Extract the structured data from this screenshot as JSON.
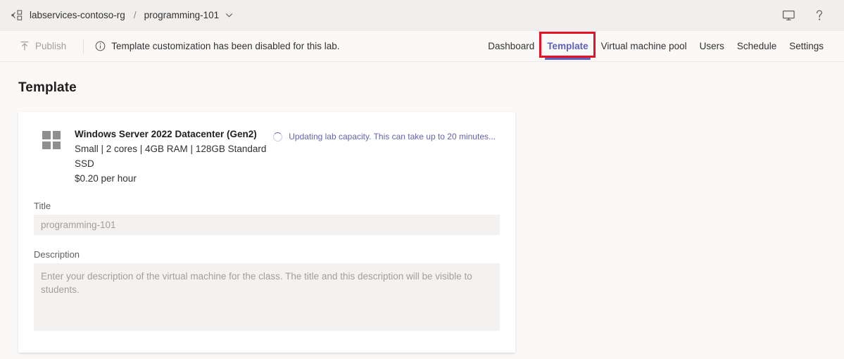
{
  "topbar": {
    "resource_group_icon": "resource-group-icon",
    "resource_group": "labservices-contoso-rg",
    "separator": "/",
    "lab_name": "programming-101",
    "caret_icon": "chevron-down-icon",
    "monitor_icon": "monitor-icon",
    "help_icon": "question-mark-icon"
  },
  "commandbar": {
    "publish_icon": "publish-upload-icon",
    "publish_label": "Publish",
    "info_icon": "info-circle-icon",
    "notice_text": "Template customization has been disabled for this lab.",
    "tabs": [
      {
        "label": "Dashboard",
        "active": false,
        "annotated": false
      },
      {
        "label": "Template",
        "active": true,
        "annotated": true
      },
      {
        "label": "Virtual machine pool",
        "active": false,
        "annotated": false
      },
      {
        "label": "Users",
        "active": false,
        "annotated": false
      },
      {
        "label": "Schedule",
        "active": false,
        "annotated": false
      },
      {
        "label": "Settings",
        "active": false,
        "annotated": false
      }
    ]
  },
  "page": {
    "title": "Template"
  },
  "card": {
    "vm_icon": "windows-logo-icon",
    "vm_name": "Windows Server 2022 Datacenter (Gen2)",
    "vm_spec": "Small | 2 cores | 4GB RAM | 128GB Standard SSD",
    "vm_price": "$0.20 per hour",
    "status_icon": "loading-spinner-icon",
    "status_text": "Updating lab capacity. This can take up to 20 minutes...",
    "title_field": {
      "label": "Title",
      "value": "programming-101"
    },
    "description_field": {
      "label": "Description",
      "value": "",
      "placeholder": "Enter your description of the virtual machine for the class. The title and this description will be visible to students."
    }
  },
  "colors": {
    "accent_purple": "#5c60c3",
    "annotation_red": "#e81123",
    "page_background": "#faf9f8",
    "topbar_background": "#f0efee",
    "field_background": "#f3f2f1"
  }
}
